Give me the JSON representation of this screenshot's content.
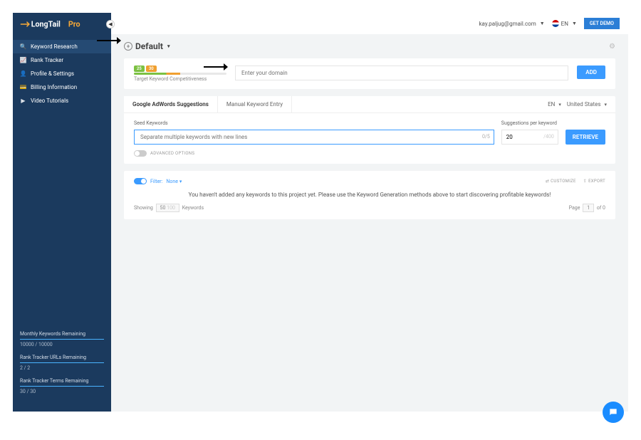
{
  "brand": "LongTailPro",
  "topbar": {
    "account": "kay.paljug@gmail.com",
    "lang": "EN",
    "demo": "GET DEMO"
  },
  "sidebar": {
    "items": [
      {
        "label": "Keyword Research"
      },
      {
        "label": "Rank Tracker"
      },
      {
        "label": "Profile & Settings"
      },
      {
        "label": "Billing Information"
      },
      {
        "label": "Video Tutorials"
      }
    ],
    "quotas": [
      {
        "label": "Monthly Keywords Remaining",
        "value": "10000 / 10000"
      },
      {
        "label": "Rank Tracker URLs Remaining",
        "value": "2 / 2"
      },
      {
        "label": "Rank Tracker Terms Remaining",
        "value": "30 / 30"
      }
    ]
  },
  "project": {
    "name": "Default"
  },
  "kc": {
    "low": "25",
    "high": "30",
    "label": "Target Keyword Competitiveness"
  },
  "domain": {
    "placeholder": "Enter your domain",
    "add": "ADD"
  },
  "tabs": {
    "a": "Google AdWords Suggestions",
    "b": "Manual Keyword Entry",
    "lang": "EN",
    "country": "United States"
  },
  "seed": {
    "label": "Seed Keywords",
    "placeholder": "Separate multiple keywords with new lines",
    "count": "0/5"
  },
  "sugg": {
    "label": "Suggestions per keyword",
    "value": "20",
    "max": "/400",
    "retrieve": "RETRIEVE"
  },
  "adv": "ADVANCED OPTIONS",
  "results": {
    "filter_label": "Filter:",
    "filter_val": "None",
    "customize": "CUSTOMIZE",
    "export": "EXPORT",
    "empty": "You haven't added any keywords to this project yet. Please use the Keyword Generation methods above to start discovering profitable keywords!",
    "showing": "Showing",
    "per": "50",
    "per_alt": "100",
    "kw": "Keywords",
    "page": "Page",
    "of": "of 0"
  }
}
